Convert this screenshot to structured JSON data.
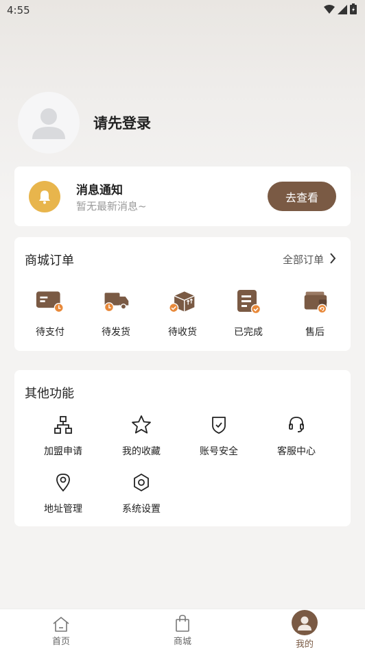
{
  "status_bar": {
    "time": "4:55"
  },
  "profile": {
    "login_prompt": "请先登录",
    "avatar_icon": "person-avatar-icon"
  },
  "notice": {
    "title": "消息通知",
    "subtitle": "暂无最新消息~",
    "button_label": "去查看",
    "icon": "bell-icon"
  },
  "orders": {
    "title": "商城订单",
    "all_label": "全部订单",
    "items": [
      {
        "label": "待支付",
        "icon": "card-clock-icon"
      },
      {
        "label": "待发货",
        "icon": "truck-icon"
      },
      {
        "label": "待收货",
        "icon": "box-icon"
      },
      {
        "label": "已完成",
        "icon": "doc-check-icon"
      },
      {
        "label": "售后",
        "icon": "wallet-return-icon"
      }
    ]
  },
  "other": {
    "title": "其他功能",
    "items": [
      {
        "label": "加盟申请",
        "icon": "org-chart-icon"
      },
      {
        "label": "我的收藏",
        "icon": "star-icon"
      },
      {
        "label": "账号安全",
        "icon": "shield-check-icon"
      },
      {
        "label": "客服中心",
        "icon": "headset-icon"
      },
      {
        "label": "地址管理",
        "icon": "location-pin-icon"
      },
      {
        "label": "系统设置",
        "icon": "hexagon-settings-icon"
      }
    ]
  },
  "tabbar": {
    "items": [
      {
        "label": "首页",
        "icon": "home-icon"
      },
      {
        "label": "商城",
        "icon": "shopping-bag-icon"
      },
      {
        "label": "我的",
        "icon": "avatar-icon"
      }
    ],
    "active_index": 2
  },
  "colors": {
    "accent_brown": "#7a5a44",
    "orange": "#e8893a",
    "bell_yellow": "#e8b54c"
  }
}
